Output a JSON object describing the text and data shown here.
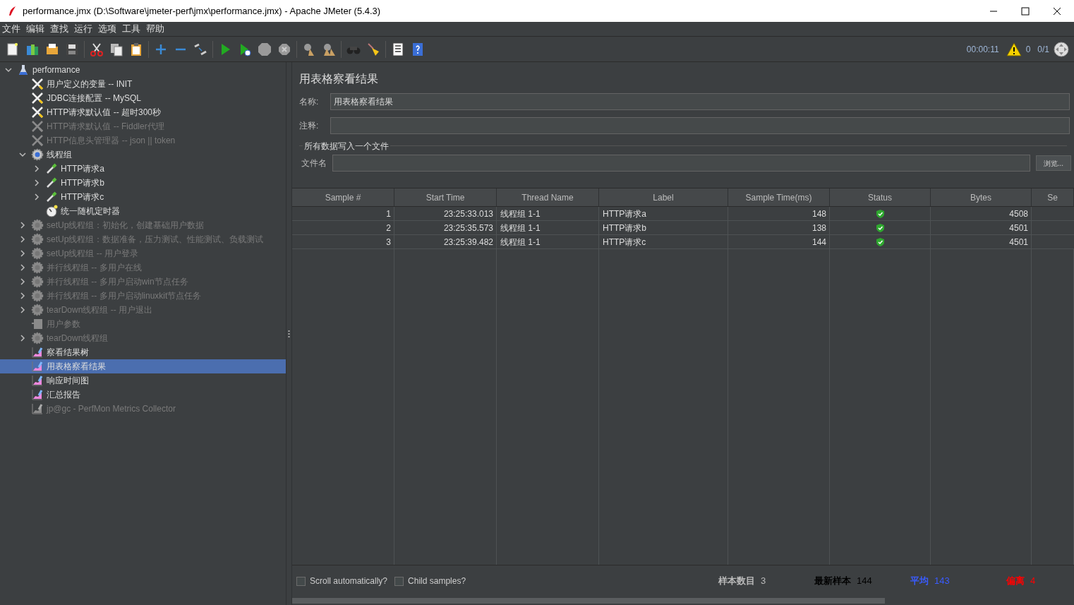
{
  "window": {
    "title": "performance.jmx (D:\\Software\\jmeter-perf\\jmx\\performance.jmx) - Apache JMeter (5.4.3)"
  },
  "menu": [
    "文件",
    "编辑",
    "查找",
    "运行",
    "选项",
    "工具",
    "帮助"
  ],
  "toolbar": [
    {
      "kind": "new"
    },
    {
      "kind": "templates"
    },
    {
      "kind": "open"
    },
    {
      "kind": "save"
    },
    {
      "kind": "sep"
    },
    {
      "kind": "cut"
    },
    {
      "kind": "copy"
    },
    {
      "kind": "paste"
    },
    {
      "kind": "sep"
    },
    {
      "kind": "expand"
    },
    {
      "kind": "collapse"
    },
    {
      "kind": "toggle"
    },
    {
      "kind": "sep"
    },
    {
      "kind": "start"
    },
    {
      "kind": "start_no_timers"
    },
    {
      "kind": "stop"
    },
    {
      "kind": "shutdown"
    },
    {
      "kind": "sep"
    },
    {
      "kind": "clear"
    },
    {
      "kind": "clear_all"
    },
    {
      "kind": "sep"
    },
    {
      "kind": "search"
    },
    {
      "kind": "reset_search"
    },
    {
      "kind": "sep"
    },
    {
      "kind": "functions"
    },
    {
      "kind": "help"
    }
  ],
  "status": {
    "elapsed": "00:00:11",
    "warnings": "0",
    "threads": "0/1"
  },
  "tree": [
    {
      "label": "performance",
      "kind": "test_plan",
      "disabled": false,
      "selected": false,
      "expanded": true,
      "children": [
        {
          "label": "用户定义的变量 -- INIT",
          "kind": "config",
          "disabled": false,
          "selected": false
        },
        {
          "label": "JDBC连接配置 -- MySQL",
          "kind": "config",
          "disabled": false,
          "selected": false
        },
        {
          "label": "HTTP请求默认值 -- 超时300秒",
          "kind": "config",
          "disabled": false,
          "selected": false
        },
        {
          "label": "HTTP请求默认值 -- Fiddler代理",
          "kind": "config",
          "disabled": true,
          "selected": false
        },
        {
          "label": "HTTP信息头管理器 -- json || token",
          "kind": "config",
          "disabled": true,
          "selected": false
        },
        {
          "label": "线程组",
          "kind": "thread_group",
          "disabled": false,
          "selected": false,
          "expanded": true,
          "children": [
            {
              "label": "HTTP请求a",
              "kind": "sampler",
              "disabled": false,
              "selected": false,
              "expanded": false
            },
            {
              "label": "HTTP请求b",
              "kind": "sampler",
              "disabled": false,
              "selected": false,
              "expanded": false
            },
            {
              "label": "HTTP请求c",
              "kind": "sampler",
              "disabled": false,
              "selected": false,
              "expanded": false
            },
            {
              "label": "统一随机定时器",
              "kind": "timer",
              "disabled": false,
              "selected": false
            }
          ]
        },
        {
          "label": "setUp线程组：初始化，创建基础用户数据",
          "kind": "thread_group",
          "disabled": true,
          "selected": false,
          "expanded": false
        },
        {
          "label": "setUp线程组：数据准备，压力测试、性能测试、负载测试",
          "kind": "thread_group",
          "disabled": true,
          "selected": false,
          "expanded": false
        },
        {
          "label": "setUp线程组 -- 用户登录",
          "kind": "thread_group",
          "disabled": true,
          "selected": false,
          "expanded": false
        },
        {
          "label": "并行线程组 -- 多用户在线",
          "kind": "thread_group",
          "disabled": true,
          "selected": false,
          "expanded": false
        },
        {
          "label": "并行线程组 -- 多用户启动win节点任务",
          "kind": "thread_group",
          "disabled": true,
          "selected": false,
          "expanded": false
        },
        {
          "label": "并行线程组 -- 多用户启动linuxkit节点任务",
          "kind": "thread_group",
          "disabled": true,
          "selected": false,
          "expanded": false
        },
        {
          "label": "tearDown线程组 -- 用户退出",
          "kind": "thread_group",
          "disabled": true,
          "selected": false,
          "expanded": false
        },
        {
          "label": "用户参数",
          "kind": "params",
          "disabled": true,
          "selected": false
        },
        {
          "label": "tearDown线程组",
          "kind": "thread_group",
          "disabled": true,
          "selected": false,
          "expanded": false
        },
        {
          "label": "察看结果树",
          "kind": "listener",
          "disabled": false,
          "selected": false
        },
        {
          "label": "用表格察看结果",
          "kind": "listener",
          "disabled": false,
          "selected": true
        },
        {
          "label": "响应时间图",
          "kind": "listener",
          "disabled": false,
          "selected": false
        },
        {
          "label": "汇总报告",
          "kind": "listener",
          "disabled": false,
          "selected": false
        },
        {
          "label": "jp@gc - PerfMon Metrics Collector",
          "kind": "listener",
          "disabled": true,
          "selected": false
        }
      ]
    }
  ],
  "panel": {
    "title": "用表格察看结果",
    "name_label": "名称:",
    "name_value": "用表格察看结果",
    "comment_label": "注释:",
    "file_group": "所有数据写入一个文件",
    "file_label": "文件名",
    "browse": "浏览..."
  },
  "table": {
    "columns": [
      "Sample #",
      "Start Time",
      "Thread Name",
      "Label",
      "Sample Time(ms)",
      "Status",
      "Bytes",
      "Se"
    ],
    "rows": [
      {
        "sample": "1",
        "start": "23:25:33.013",
        "thread": "线程组 1-1",
        "label": "HTTP请求a",
        "time": "148",
        "success": true,
        "bytes": "4508"
      },
      {
        "sample": "2",
        "start": "23:25:35.573",
        "thread": "线程组 1-1",
        "label": "HTTP请求b",
        "time": "138",
        "success": true,
        "bytes": "4501"
      },
      {
        "sample": "3",
        "start": "23:25:39.482",
        "thread": "线程组 1-1",
        "label": "HTTP请求c",
        "time": "144",
        "success": true,
        "bytes": "4501"
      }
    ]
  },
  "options": [
    {
      "label": "Scroll automatically?",
      "checked": false
    },
    {
      "label": "Child samples?",
      "checked": false
    }
  ],
  "stats": [
    {
      "label": "样本数目",
      "value": "3",
      "color": "#bbbbbb"
    },
    {
      "label": "最新样本",
      "value": "144",
      "color": "#000000"
    },
    {
      "label": "平均",
      "value": "143",
      "color": "#3a5cff"
    },
    {
      "label": "偏离",
      "value": "4",
      "color": "#ff0000"
    }
  ]
}
